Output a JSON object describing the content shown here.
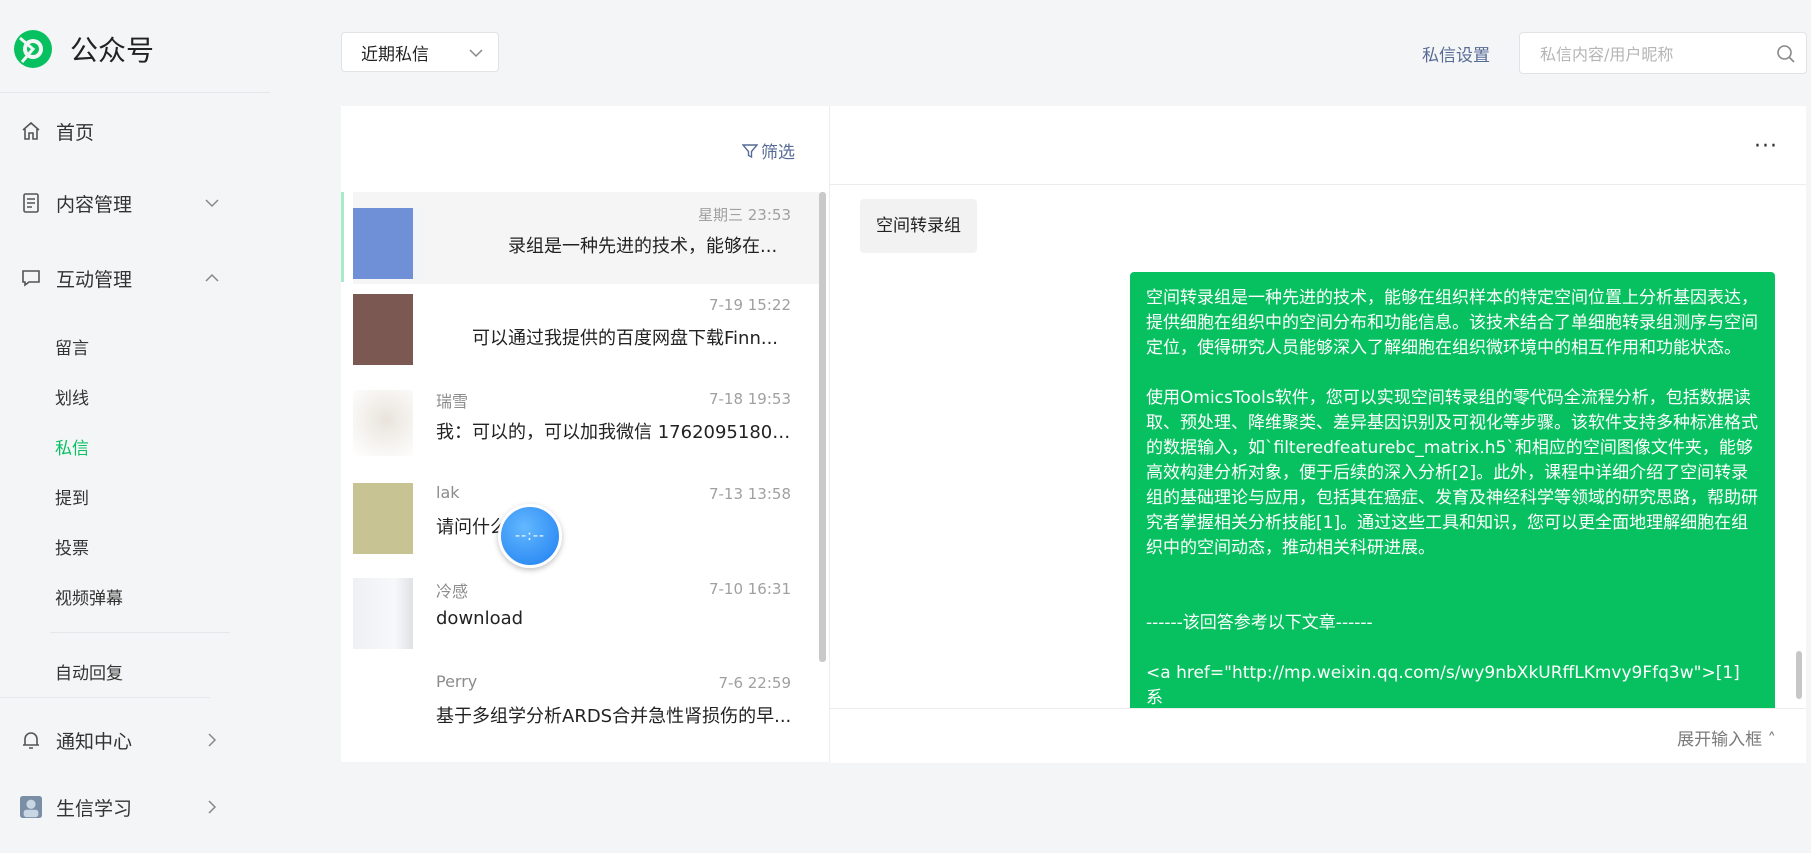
{
  "brand": {
    "name": "公众号"
  },
  "nav": {
    "home": "首页",
    "content": "内容管理",
    "interaction": "互动管理",
    "sub_items": [
      "留言",
      "划线",
      "私信",
      "提到",
      "投票",
      "视频弹幕"
    ],
    "auto_reply": "自动回复",
    "notifications": "通知中心",
    "account": "生信学习"
  },
  "header": {
    "filter_select": "近期私信",
    "settings_link": "私信设置",
    "search_placeholder": "私信内容/用户昵称"
  },
  "list": {
    "filter_label": "筛选",
    "rows": [
      {
        "name": "",
        "time": "星期三 23:53",
        "preview": "录组是一种先进的技术，能够在..."
      },
      {
        "name": "",
        "time": "7-19 15:22",
        "preview": "可以通过我提供的百度网盘下载Finn..."
      },
      {
        "name": "瑞雪",
        "time": "7-18 19:53",
        "preview": "我：可以的，可以加我微信 17620951804 ..."
      },
      {
        "name": "lak",
        "time": "7-13 13:58",
        "preview": "请问什么"
      },
      {
        "name": "冷感",
        "time": "7-10 16:31",
        "preview": "download"
      },
      {
        "name": "Perry",
        "time": "7-6 22:59",
        "preview": "基于多组学分析ARDS合并急性肾损伤的早..."
      }
    ],
    "floating_bubble": "--:--"
  },
  "chat": {
    "incoming": "空间转录组",
    "outgoing": "空间转录组是一种先进的技术，能够在组织样本的特定空间位置上分析基因表达，提供细胞在组织中的空间分布和功能信息。该技术结合了单细胞转录组测序与空间定位，使得研究人员能够深入了解细胞在组织微环境中的相互作用和功能状态。\n\n使用OmicsTools软件，您可以实现空间转录组的零代码全流程分析，包括数据读取、预处理、降维聚类、差异基因识别及可视化等步骤。该软件支持多种标准格式的数据输入，如`filteredfeaturebc_matrix.h5`和相应的空间图像文件夹，能够高效构建分析对象，便于后续的深入分析[2]。此外，课程中详细介绍了空间转录组的基础理论与应用，包括其在癌症、发育及神经科学等领域的研究思路，帮助研究者掌握相关分析技能[1]。通过这些工具和知识，您可以更全面地理解细胞在组织中的空间动态，推动相关科研进展。\n\n\n------该回答参考以下文章------\n\n<a href=\"http://mp.weixin.qq.com/s/wy9nbXkURffLKmvy9Ffq3w\">[1] 系",
    "expand_input": "展开输入框"
  },
  "colors": {
    "accent": "#07c160",
    "link": "#576b95",
    "background": "#f4f5f7"
  }
}
